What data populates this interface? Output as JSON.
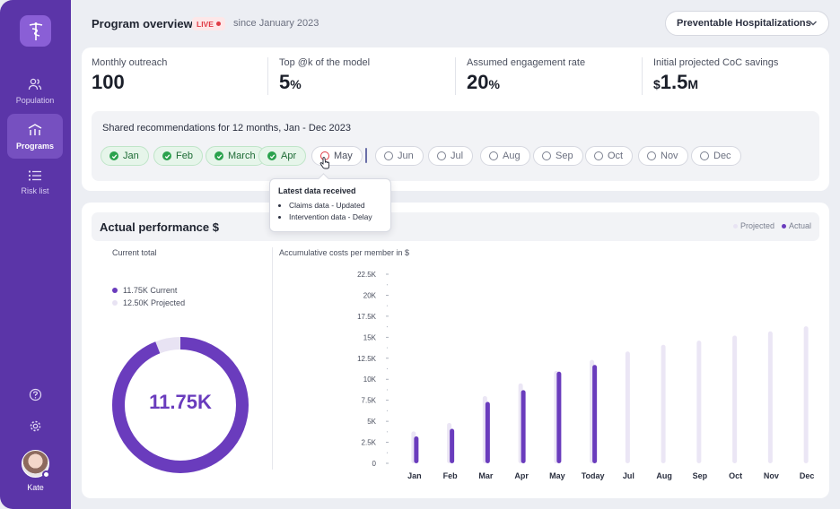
{
  "sidebar": {
    "items": [
      {
        "label": "Population",
        "icon": "users-icon",
        "active": false
      },
      {
        "label": "Programs",
        "icon": "programs-icon",
        "active": true
      },
      {
        "label": "Risk list",
        "icon": "list-icon",
        "active": false
      }
    ],
    "bottom_icons": [
      "help-icon",
      "settings-icon"
    ],
    "user": {
      "name": "Kate"
    }
  },
  "header": {
    "title": "Program overview",
    "live_label": "LIVE",
    "since": "since January 2023",
    "dropdown_value": "Preventable Hospitalizations"
  },
  "metrics": [
    {
      "label": "Monthly outreach",
      "value": "100",
      "unit": ""
    },
    {
      "label": "Top @k of the model",
      "value": "5",
      "unit": "%"
    },
    {
      "label": "Assumed engagement rate",
      "value": "20",
      "unit": "%"
    },
    {
      "label": "Initial projected CoC savings",
      "prefix": "$",
      "value": "1.5",
      "unit": "M"
    }
  ],
  "recommendations": {
    "title": "Shared recommendations for 12 months, Jan - Dec 2023",
    "months": [
      {
        "label": "Jan",
        "status": "done"
      },
      {
        "label": "Feb",
        "status": "done"
      },
      {
        "label": "March",
        "status": "done"
      },
      {
        "label": "Apr",
        "status": "done"
      },
      {
        "label": "May",
        "status": "warning"
      },
      {
        "label": "Jun",
        "status": "pending"
      },
      {
        "label": "Jul",
        "status": "pending"
      },
      {
        "label": "Aug",
        "status": "pending"
      },
      {
        "label": "Sep",
        "status": "pending"
      },
      {
        "label": "Oct",
        "status": "pending"
      },
      {
        "label": "Nov",
        "status": "pending"
      },
      {
        "label": "Dec",
        "status": "pending"
      }
    ]
  },
  "tooltip": {
    "title": "Latest data received",
    "items": [
      "Claims data - Updated",
      "Intervention data - Delay"
    ]
  },
  "performance": {
    "title": "Actual performance $",
    "legend": {
      "projected": "Projected",
      "actual": "Actual"
    },
    "current_total_label": "Current total",
    "current_value": "11.75K",
    "current_label": "Current",
    "projected_value": "12.50K",
    "projected_label": "Projected",
    "donut_center": "11.75K",
    "chart_title": "Accumulative costs per member in $"
  },
  "colors": {
    "sidebar": "#5b35a8",
    "actual": "#6a3cbd",
    "projected": "#ebe6f5",
    "success": "#2aa24d",
    "live": "#e03b45"
  },
  "chart_data": [
    {
      "type": "pie",
      "title": "Current total",
      "categories": [
        "Current",
        "Projected"
      ],
      "values": [
        11.75,
        12.5
      ],
      "unit": "K"
    },
    {
      "type": "bar",
      "title": "Accumulative costs per member in $",
      "categories": [
        "Jan",
        "Feb",
        "Mar",
        "Apr",
        "May",
        "Today",
        "Jul",
        "Aug",
        "Sep",
        "Oct",
        "Nov",
        "Dec"
      ],
      "yticks": [
        "0",
        "2.5K",
        "5K",
        "7.5K",
        "10K",
        "12.5K",
        "15K",
        "17.5K",
        "20K",
        "22.5K"
      ],
      "ylim": [
        0,
        22500
      ],
      "series": [
        {
          "name": "Projected",
          "values": [
            3800,
            4800,
            8000,
            9500,
            11000,
            12300,
            13300,
            14100,
            14600,
            15200,
            15700,
            16300
          ]
        },
        {
          "name": "Actual",
          "values": [
            3200,
            4100,
            7300,
            8700,
            10900,
            11700,
            null,
            null,
            null,
            null,
            null,
            null
          ]
        }
      ]
    }
  ]
}
